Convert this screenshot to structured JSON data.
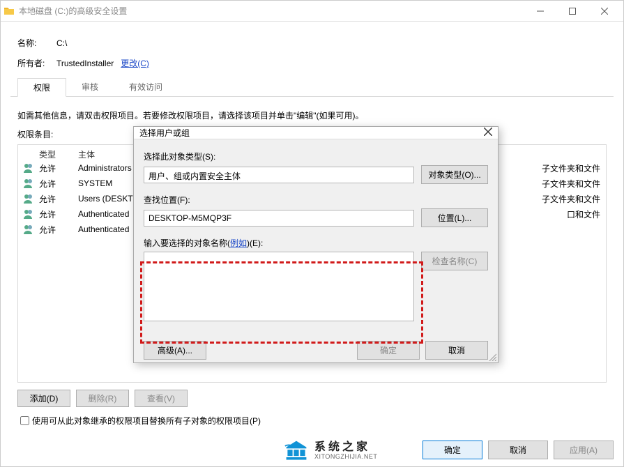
{
  "window": {
    "title": "本地磁盘 (C:)的高级安全设置"
  },
  "info": {
    "name_label": "名称:",
    "name_value": "C:\\",
    "owner_label": "所有者:",
    "owner_value": "TrustedInstaller",
    "change_link": "更改(C)"
  },
  "tabs": [
    "权限",
    "审核",
    "有效访问"
  ],
  "help_text": "如需其他信息，请双击权限项目。若要修改权限项目，请选择该项目并单击\"编辑\"(如果可用)。",
  "perm_list_label": "权限条目:",
  "perm_headers": {
    "type": "类型",
    "principal": "主体"
  },
  "perm_rows": [
    {
      "type": "允许",
      "principal": "Administrators",
      "applies": "子文件夹和文件"
    },
    {
      "type": "允许",
      "principal": "SYSTEM",
      "applies": "子文件夹和文件"
    },
    {
      "type": "允许",
      "principal": "Users (DESKTO",
      "applies": "子文件夹和文件"
    },
    {
      "type": "允许",
      "principal": "Authenticated",
      "applies": "口和文件"
    },
    {
      "type": "允许",
      "principal": "Authenticated",
      "applies": ""
    }
  ],
  "row_buttons": {
    "add": "添加(D)",
    "remove": "删除(R)",
    "view": "查看(V)"
  },
  "checkbox_label": "使用可从此对象继承的权限项目替换所有子对象的权限项目(P)",
  "bottom_buttons": {
    "ok": "确定",
    "cancel": "取消",
    "apply": "应用(A)"
  },
  "modal": {
    "title": "选择用户或组",
    "object_type_label": "选择此对象类型(S):",
    "object_type_value": "用户、组或内置安全主体",
    "object_type_btn": "对象类型(O)...",
    "location_label": "查找位置(F):",
    "location_value": "DESKTOP-M5MQP3F",
    "location_btn": "位置(L)...",
    "name_label_prefix": "输入要选择的对象名称(",
    "name_label_link": "例如",
    "name_label_suffix": ")(E):",
    "check_btn": "检查名称(C)",
    "advanced_btn": "高级(A)...",
    "ok_btn": "确定",
    "cancel_btn": "取消"
  },
  "watermark": {
    "cn": "系统之家",
    "en": "XITONGZHIJIA.NET"
  }
}
